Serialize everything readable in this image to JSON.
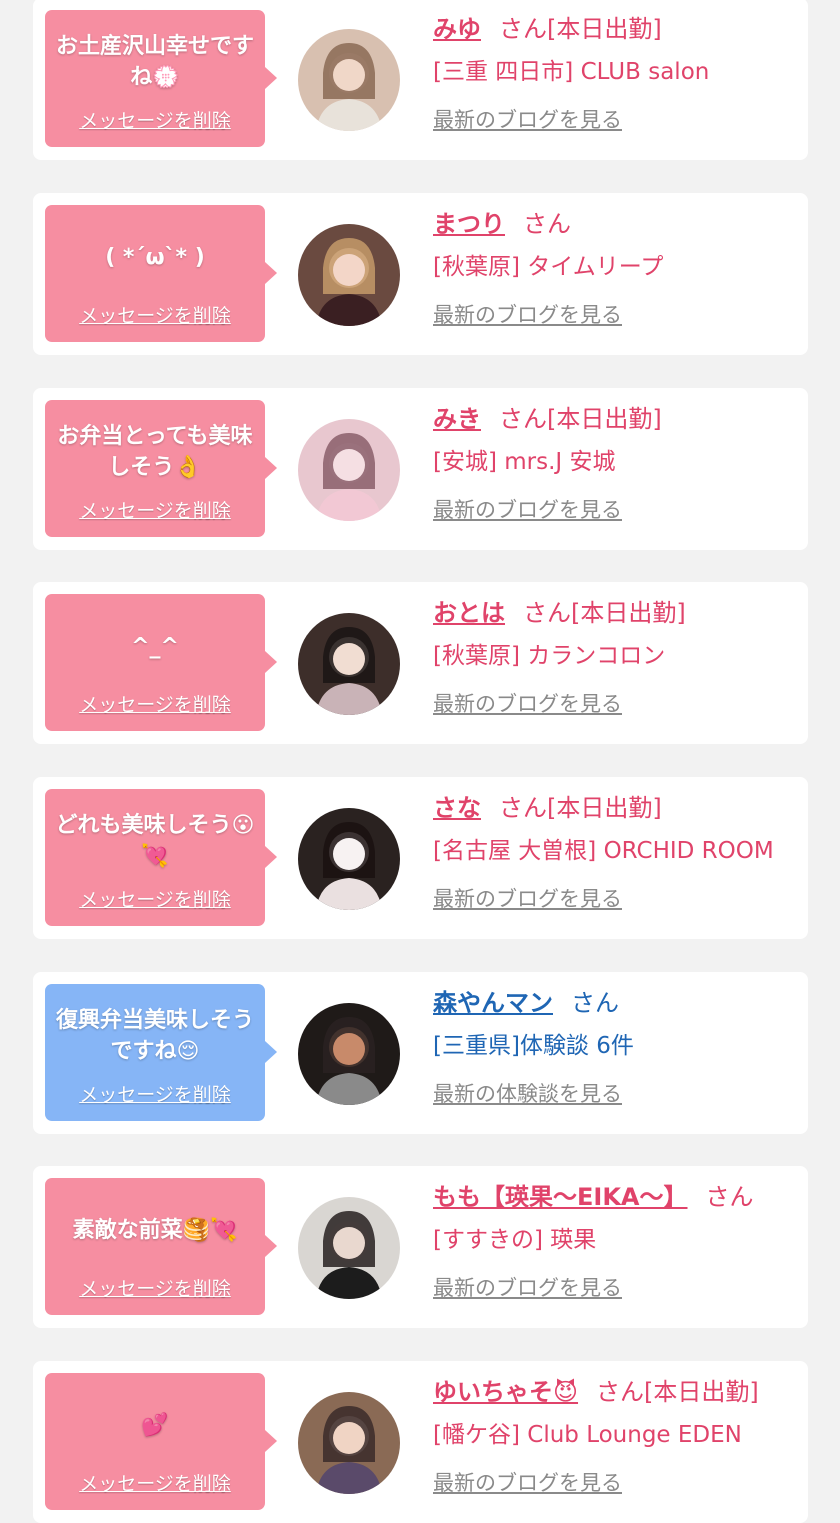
{
  "delete_label": "メッセージを削除",
  "colors": {
    "pink_bubble": "#f68ea1",
    "blue_bubble": "#86b5f6",
    "pink_text": "#e0436a",
    "blue_text": "#1f66b4",
    "link_gray": "#8a8a8a",
    "background": "#f2f2f2"
  },
  "items": [
    {
      "bubble_color": "pink",
      "message": "お土産沢山幸せですね💮",
      "name": "みゆ",
      "suffix": "さん[本日出勤]",
      "store": "[三重 四日市] CLUB salon",
      "link": "最新のブログを見る",
      "avatar_icon": "avatar-photo-icon"
    },
    {
      "bubble_color": "pink",
      "message": "( *´ω`* )",
      "name": "まつり",
      "suffix": "さん",
      "store": "[秋葉原] タイムリープ",
      "link": "最新のブログを見る",
      "avatar_icon": "avatar-photo-icon"
    },
    {
      "bubble_color": "pink",
      "message": "お弁当とっても美味しそう👌",
      "name": "みき",
      "suffix": "さん[本日出勤]",
      "store": "[安城] mrs.J 安城",
      "link": "最新のブログを見る",
      "avatar_icon": "avatar-photo-icon"
    },
    {
      "bubble_color": "pink",
      "message": "^_^",
      "name": "おとは",
      "suffix": "さん[本日出勤]",
      "store": "[秋葉原] カランコロン",
      "link": "最新のブログを見る",
      "avatar_icon": "avatar-photo-icon"
    },
    {
      "bubble_color": "pink",
      "message": "どれも美味しそう😮💘",
      "name": "さな",
      "suffix": "さん[本日出勤]",
      "store": "[名古屋 大曽根] ORCHID ROOM",
      "link": "最新のブログを見る",
      "avatar_icon": "avatar-photo-icon"
    },
    {
      "bubble_color": "blue",
      "message": "復興弁当美味しそうですね😌",
      "name": "森やんマン",
      "suffix": "さん",
      "store": "[三重県]体験談 6件",
      "link": "最新の体験談を見る",
      "avatar_icon": "avatar-photo-icon"
    },
    {
      "bubble_color": "pink",
      "message": "素敵な前菜🥞💘",
      "name": "もも【瑛果〜EIKA〜】",
      "suffix": "さん",
      "store": "[すすきの] 瑛果",
      "link": "最新のブログを見る",
      "avatar_icon": "avatar-photo-icon"
    },
    {
      "bubble_color": "pink",
      "message": "💕",
      "name": "ゆいちゃそ😈",
      "suffix": "さん[本日出勤]",
      "store": "[幡ケ谷] Club Lounge EDEN",
      "link": "最新のブログを見る",
      "avatar_icon": "avatar-photo-icon"
    }
  ]
}
